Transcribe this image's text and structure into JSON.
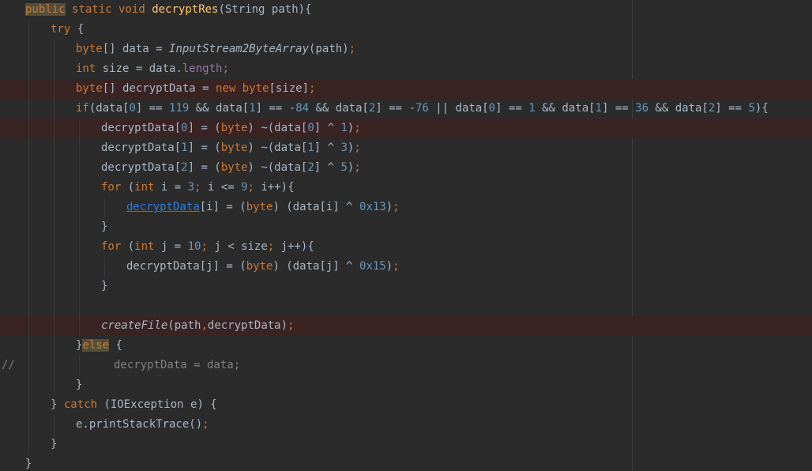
{
  "editor": {
    "language": "java",
    "colors": {
      "background": "#2b2b2b",
      "text": "#a9b7c6",
      "keyword": "#cc7832",
      "method_decl": "#ffc66d",
      "number": "#6897bb",
      "field": "#9876aa",
      "comment": "#808080",
      "breakpoint_line": "#3a2323",
      "keyword_highlight": "#52503a"
    },
    "lines": [
      {
        "indent": 1,
        "tokens": [
          [
            "kw kw-hl",
            "public"
          ],
          [
            "p",
            " "
          ],
          [
            "kw",
            "static"
          ],
          [
            "p",
            " "
          ],
          [
            "kw",
            "void"
          ],
          [
            "p",
            " "
          ],
          [
            "fn",
            "decryptRes"
          ],
          [
            "p",
            "(String path){"
          ]
        ]
      },
      {
        "indent": 2,
        "tokens": [
          [
            "kw",
            "try"
          ],
          [
            "p",
            " {"
          ]
        ]
      },
      {
        "indent": 3,
        "tokens": [
          [
            "kw",
            "byte"
          ],
          [
            "p",
            "[] data = "
          ],
          [
            "it",
            "InputStream2ByteArray"
          ],
          [
            "p",
            "(path)"
          ],
          [
            "semi",
            ";"
          ]
        ]
      },
      {
        "indent": 3,
        "tokens": [
          [
            "kw",
            "int"
          ],
          [
            "p",
            " size = data."
          ],
          [
            "fld",
            "length"
          ],
          [
            "semi",
            ";"
          ]
        ]
      },
      {
        "indent": 3,
        "bp": true,
        "tokens": [
          [
            "kw",
            "byte"
          ],
          [
            "p",
            "[] decryptData = "
          ],
          [
            "kw",
            "new"
          ],
          [
            "p",
            " "
          ],
          [
            "kw",
            "byte"
          ],
          [
            "p",
            "[size]"
          ],
          [
            "semi",
            ";"
          ]
        ]
      },
      {
        "indent": 3,
        "tokens": [
          [
            "kw",
            "if"
          ],
          [
            "p",
            "(data["
          ],
          [
            "num",
            "0"
          ],
          [
            "p",
            "] == "
          ],
          [
            "num",
            "119"
          ],
          [
            "p",
            " && data["
          ],
          [
            "num",
            "1"
          ],
          [
            "p",
            "] == -"
          ],
          [
            "num",
            "84"
          ],
          [
            "p",
            " && data["
          ],
          [
            "num",
            "2"
          ],
          [
            "p",
            "] == -"
          ],
          [
            "num",
            "76"
          ],
          [
            "p",
            " || data["
          ],
          [
            "num",
            "0"
          ],
          [
            "p",
            "] == "
          ],
          [
            "num",
            "1"
          ],
          [
            "p",
            " && data["
          ],
          [
            "num",
            "1"
          ],
          [
            "p",
            "] == "
          ],
          [
            "num",
            "36"
          ],
          [
            "p",
            " && data["
          ],
          [
            "num",
            "2"
          ],
          [
            "p",
            "] == "
          ],
          [
            "num",
            "5"
          ],
          [
            "p",
            "){"
          ]
        ]
      },
      {
        "indent": 4,
        "bp": true,
        "tokens": [
          [
            "p",
            "decryptData["
          ],
          [
            "num",
            "0"
          ],
          [
            "p",
            "] = ("
          ],
          [
            "kw",
            "byte"
          ],
          [
            "p",
            ") ~(data["
          ],
          [
            "num",
            "0"
          ],
          [
            "p",
            "] ^ "
          ],
          [
            "num",
            "1"
          ],
          [
            "p",
            ")"
          ],
          [
            "semi",
            ";"
          ]
        ]
      },
      {
        "indent": 4,
        "tokens": [
          [
            "p",
            "decryptData["
          ],
          [
            "num",
            "1"
          ],
          [
            "p",
            "] = ("
          ],
          [
            "kw",
            "byte"
          ],
          [
            "p",
            ") ~(data["
          ],
          [
            "num",
            "1"
          ],
          [
            "p",
            "] ^ "
          ],
          [
            "num",
            "3"
          ],
          [
            "p",
            ")"
          ],
          [
            "semi",
            ";"
          ]
        ]
      },
      {
        "indent": 4,
        "tokens": [
          [
            "p",
            "decryptData["
          ],
          [
            "num",
            "2"
          ],
          [
            "p",
            "] = ("
          ],
          [
            "kw",
            "byte"
          ],
          [
            "p",
            ") ~(data["
          ],
          [
            "num",
            "2"
          ],
          [
            "p",
            "] ^ "
          ],
          [
            "num",
            "5"
          ],
          [
            "p",
            ")"
          ],
          [
            "semi",
            ";"
          ]
        ]
      },
      {
        "indent": 4,
        "tokens": [
          [
            "kw",
            "for"
          ],
          [
            "p",
            " ("
          ],
          [
            "kw",
            "int"
          ],
          [
            "p",
            " i = "
          ],
          [
            "num",
            "3"
          ],
          [
            "semi",
            ";"
          ],
          [
            "p",
            " i <= "
          ],
          [
            "num",
            "9"
          ],
          [
            "semi",
            ";"
          ],
          [
            "p",
            " i++){"
          ]
        ]
      },
      {
        "indent": 5,
        "tokens": [
          [
            "link",
            "decryptData"
          ],
          [
            "p",
            "[i] = ("
          ],
          [
            "kw",
            "byte"
          ],
          [
            "p",
            ") (data[i] ^ "
          ],
          [
            "num",
            "0x13"
          ],
          [
            "p",
            ")"
          ],
          [
            "semi",
            ";"
          ]
        ]
      },
      {
        "indent": 4,
        "tokens": [
          [
            "p",
            "}"
          ]
        ]
      },
      {
        "indent": 4,
        "tokens": [
          [
            "kw",
            "for"
          ],
          [
            "p",
            " ("
          ],
          [
            "kw",
            "int"
          ],
          [
            "p",
            " j = "
          ],
          [
            "num",
            "10"
          ],
          [
            "semi",
            ";"
          ],
          [
            "p",
            " j < size"
          ],
          [
            "semi",
            ";"
          ],
          [
            "p",
            " j++){"
          ]
        ]
      },
      {
        "indent": 5,
        "tokens": [
          [
            "p",
            "decryptData[j] = ("
          ],
          [
            "kw",
            "byte"
          ],
          [
            "p",
            ") (data[j] ^ "
          ],
          [
            "num",
            "0x15"
          ],
          [
            "p",
            ")"
          ],
          [
            "semi",
            ";"
          ]
        ]
      },
      {
        "indent": 4,
        "tokens": [
          [
            "p",
            "}"
          ]
        ]
      },
      {
        "indent": 4,
        "tokens": []
      },
      {
        "indent": 4,
        "bp": true,
        "tokens": [
          [
            "it",
            "createFile"
          ],
          [
            "p",
            "(path"
          ],
          [
            "semi",
            ","
          ],
          [
            "p",
            "decryptData)"
          ],
          [
            "semi",
            ";"
          ]
        ]
      },
      {
        "indent": 3,
        "tokens": [
          [
            "p",
            "}"
          ],
          [
            "kw kw-hl",
            "else"
          ],
          [
            "p",
            " {"
          ]
        ]
      },
      {
        "indent": 4,
        "comment_prefix": "//",
        "offset": 16,
        "tokens": [
          [
            "cmt",
            "decryptData = data;"
          ]
        ]
      },
      {
        "indent": 3,
        "tokens": [
          [
            "p",
            "}"
          ]
        ]
      },
      {
        "indent": 2,
        "tokens": [
          [
            "p",
            "} "
          ],
          [
            "kw",
            "catch"
          ],
          [
            "p",
            " (IOException e) {"
          ]
        ]
      },
      {
        "indent": 3,
        "tokens": [
          [
            "p",
            "e.printStackTrace()"
          ],
          [
            "semi",
            ";"
          ]
        ]
      },
      {
        "indent": 2,
        "tokens": [
          [
            "p",
            "}"
          ]
        ]
      },
      {
        "indent": 1,
        "tokens": [
          [
            "p",
            "}"
          ]
        ]
      }
    ]
  }
}
